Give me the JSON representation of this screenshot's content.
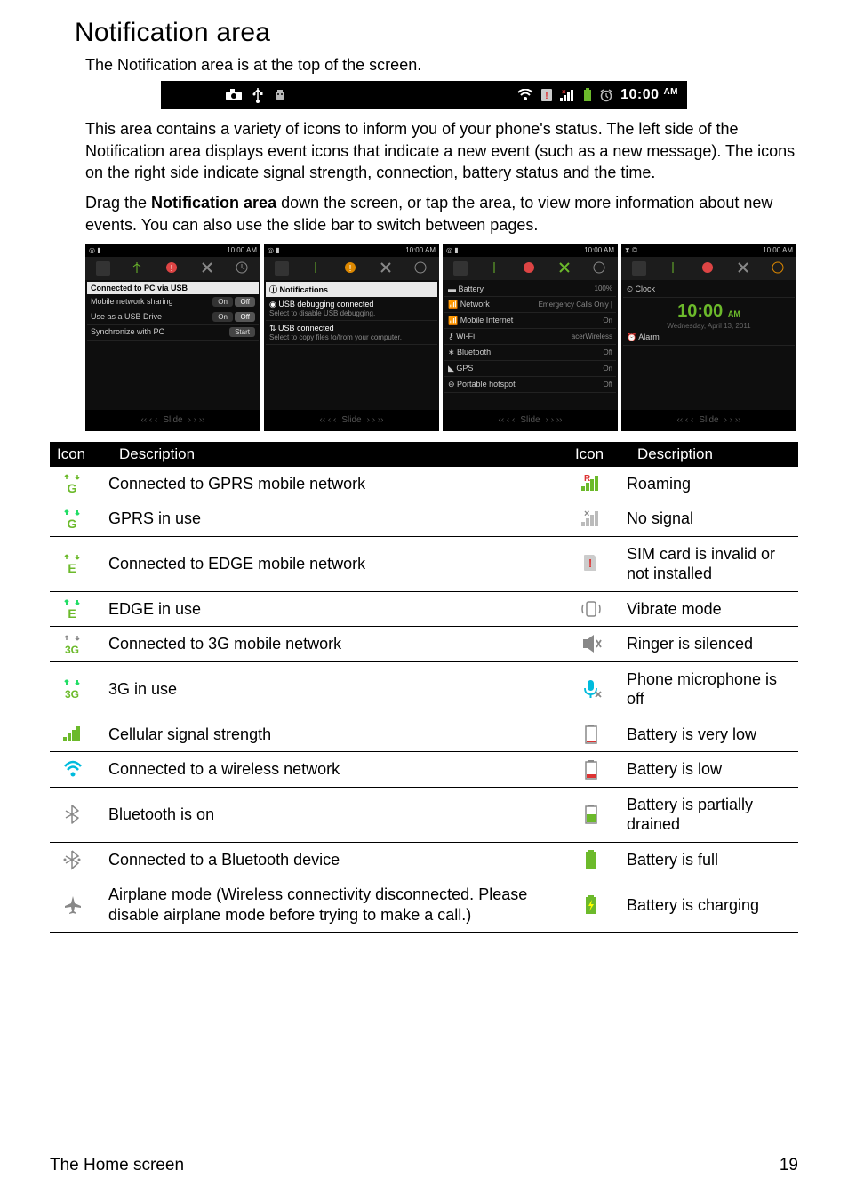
{
  "title": "Notification area",
  "intro": "The Notification area is at the top of the screen.",
  "statusbar_time": "10:00",
  "statusbar_ampm": "AM",
  "paragraph1": "This area contains a variety of icons to inform you of your phone's status. The left side of the Notification area displays event icons that indicate a new event (such as a new message). The icons on the right side indicate signal strength, connection, battery status and the time.",
  "paragraph2_pre": "Drag the ",
  "paragraph2_bold": "Notification area",
  "paragraph2_post": " down the screen, or tap the area, to view more information about new events. You can also use the slide bar to switch between pages.",
  "shots": [
    {
      "time": "10:00 AM",
      "header": "Connected to PC via USB",
      "rows": [
        {
          "label": "Mobile network sharing",
          "value": "On",
          "value2": "Off"
        },
        {
          "label": "Use as a USB Drive",
          "value": "On",
          "value2": "Off"
        },
        {
          "label": "Synchronize with PC",
          "value": "Start"
        }
      ],
      "slide": "Slide"
    },
    {
      "time": "10:00 AM",
      "header": "Notifications",
      "rows": [
        {
          "label": "USB debugging connected",
          "sub": "Select to disable USB debugging."
        },
        {
          "label": "USB connected",
          "sub": "Select to copy files to/from your computer."
        }
      ],
      "slide": "Slide"
    },
    {
      "time": "10:00 AM",
      "rows": [
        {
          "label": "Battery",
          "value": "100%"
        },
        {
          "label": "Network",
          "value": "Emergency Calls Only |"
        },
        {
          "label": "Mobile Internet",
          "value": "On"
        },
        {
          "label": "Wi-Fi",
          "value": "acerWireless"
        },
        {
          "label": "Bluetooth",
          "value": "Off"
        },
        {
          "label": "GPS",
          "value": "On"
        },
        {
          "label": "Portable hotspot",
          "value": "Off"
        }
      ],
      "slide": "Slide"
    },
    {
      "time": "10:00 AM",
      "header": "Clock",
      "clock_time": "10:00",
      "clock_ampm": "AM",
      "clock_date": "Wednesday, April 13, 2011",
      "header2": "Alarm",
      "slide": "Slide"
    }
  ],
  "table": {
    "head": [
      "Icon",
      "Description",
      "Icon",
      "Description"
    ],
    "rows": [
      {
        "icon1": "gprs",
        "desc1": "Connected to GPRS mobile network",
        "icon2": "roaming",
        "desc2": "Roaming"
      },
      {
        "icon1": "gprs-use",
        "desc1": "GPRS in use",
        "icon2": "no-signal",
        "desc2": "No signal"
      },
      {
        "icon1": "edge",
        "desc1": "Connected to EDGE mobile network",
        "icon2": "sim-invalid",
        "desc2": "SIM card is invalid or not installed"
      },
      {
        "icon1": "edge-use",
        "desc1": "EDGE in use",
        "icon2": "vibrate",
        "desc2": "Vibrate mode"
      },
      {
        "icon1": "threeg",
        "desc1": "Connected to 3G mobile network",
        "icon2": "ringer-silenced",
        "desc2": "Ringer is silenced"
      },
      {
        "icon1": "threeg-use",
        "desc1": "3G in use",
        "icon2": "mic-off",
        "desc2": "Phone microphone is off"
      },
      {
        "icon1": "signal",
        "desc1": "Cellular signal strength",
        "icon2": "batt-very-low",
        "desc2": "Battery is very low"
      },
      {
        "icon1": "wifi",
        "desc1": "Connected to a wireless network",
        "icon2": "batt-low",
        "desc2": "Battery is low"
      },
      {
        "icon1": "bluetooth",
        "desc1": "Bluetooth is on",
        "icon2": "batt-partial",
        "desc2": "Battery is partially drained"
      },
      {
        "icon1": "bluetooth-connected",
        "desc1": "Connected to a Bluetooth device",
        "icon2": "batt-full",
        "desc2": "Battery is full"
      },
      {
        "icon1": "airplane",
        "desc1": "Airplane mode (Wireless connectivity disconnected. Please disable airplane mode before trying to make a call.)",
        "icon2": "batt-charging",
        "desc2": "Battery is charging"
      }
    ]
  },
  "footer": {
    "left": "The Home screen",
    "right": "19"
  }
}
